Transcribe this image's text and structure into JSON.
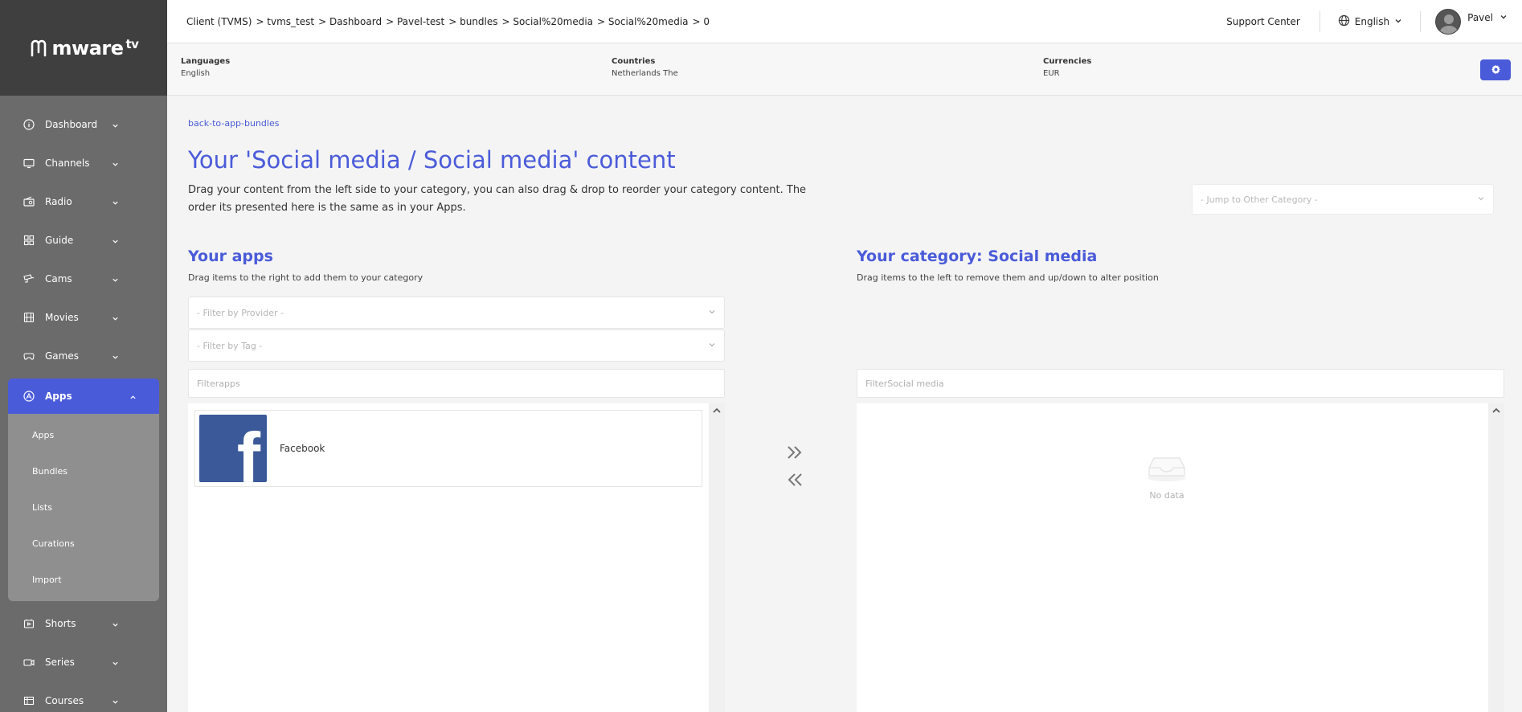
{
  "sidebar": {
    "logo_text": "mware",
    "logo_sup": "tv",
    "items": [
      {
        "label": "Dashboard",
        "icon": "info-circle-icon"
      },
      {
        "label": "Channels",
        "icon": "tv-icon"
      },
      {
        "label": "Radio",
        "icon": "radio-icon"
      },
      {
        "label": "Guide",
        "icon": "guide-grid-icon"
      },
      {
        "label": "Cams",
        "icon": "cam-icon"
      },
      {
        "label": "Movies",
        "icon": "film-icon"
      },
      {
        "label": "Games",
        "icon": "gamepad-icon"
      },
      {
        "label": "Apps",
        "icon": "apps-icon"
      },
      {
        "label": "Shorts",
        "icon": "shorts-icon"
      },
      {
        "label": "Series",
        "icon": "series-icon"
      },
      {
        "label": "Courses",
        "icon": "courses-icon"
      }
    ],
    "apps_submenu": [
      "Apps",
      "Bundles",
      "Lists",
      "Curations",
      "Import"
    ]
  },
  "topbar": {
    "breadcrumbs": [
      "Client (TVMS)",
      "> tvms_test",
      "> Dashboard",
      "> Pavel-test",
      "> bundles",
      "> Social%20media",
      "> Social%20media",
      "> 0"
    ],
    "support": "Support Center",
    "language": "English",
    "user": "Pavel"
  },
  "infobar": {
    "languages_label": "Languages",
    "languages_value": "English",
    "countries_label": "Countries",
    "countries_value": "Netherlands The",
    "currencies_label": "Currencies",
    "currencies_value": "EUR"
  },
  "main": {
    "back_link": "back-to-app-bundles",
    "title": "Your 'Social media / Social media' content",
    "description": "Drag your content from the left side to your category, you can also drag & drop to reorder your category content. The order its presented here is the same as in your Apps.",
    "jump_placeholder": "- Jump to Other Category -",
    "left": {
      "title": "Your apps",
      "subtitle": "Drag items to the right to add them to your category",
      "provider_filter": "- Filter by Provider -",
      "tag_filter": "- Filter by Tag -",
      "search_placeholder": "Filterapps",
      "items": [
        {
          "name": "Facebook"
        }
      ]
    },
    "right": {
      "title": "Your category: Social media",
      "subtitle": "Drag items to the left to remove them and up/down to alter position",
      "search_placeholder": "FilterSocial media",
      "empty_text": "No data"
    }
  },
  "colors": {
    "accent": "#4a5bd9",
    "sidebar_bg": "#6b6b6b",
    "logo_bg": "#3f3f3f",
    "facebook": "#3b5998"
  }
}
